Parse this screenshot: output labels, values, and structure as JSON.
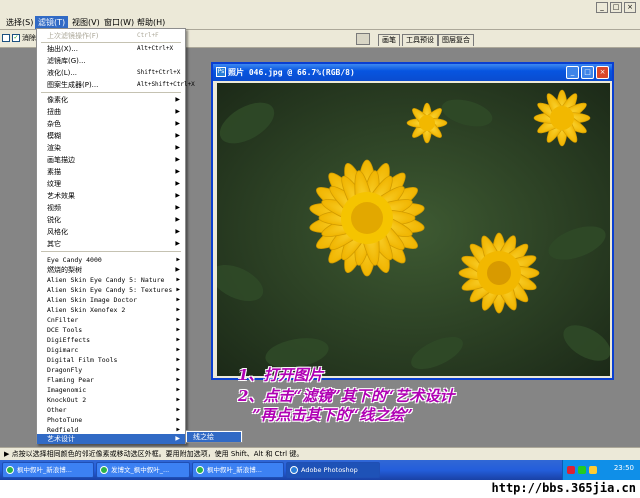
{
  "menubar": {
    "items": [
      "选择(S)",
      "滤镜(T)",
      "视图(V)",
      "窗口(W)",
      "帮助(H)"
    ],
    "active_index": 1,
    "window_controls": [
      "_",
      "□",
      "×"
    ]
  },
  "options_bar": {
    "checkbox_label": "消除",
    "palette_tabs": [
      "画笔",
      "工具预设",
      "图层复合"
    ]
  },
  "document": {
    "title": "照片 046.jpg @ 66.7%(RGB/8)",
    "controls": [
      "_",
      "□",
      "×"
    ]
  },
  "filter_menu": {
    "top_items": [
      {
        "label": "上次滤镜操作(F)",
        "shortcut": "Ctrl+F",
        "disabled": true
      },
      {
        "label": "抽出(X)...",
        "shortcut": "Alt+Ctrl+X"
      },
      {
        "label": "滤镜库(G)...",
        "shortcut": ""
      },
      {
        "label": "液化(L)...",
        "shortcut": "Shift+Ctrl+X"
      },
      {
        "label": "图案生成器(P)...",
        "shortcut": "Alt+Shift+Ctrl+X"
      }
    ],
    "groups": [
      "像素化",
      "扭曲",
      "杂色",
      "模糊",
      "渲染",
      "画笔描边",
      "素描",
      "纹理",
      "艺术效果",
      "视频",
      "锐化",
      "风格化",
      "其它"
    ],
    "plugins": [
      "Eye Candy 4000",
      "燃烧的梨树",
      "Alien Skin Eye Candy 5: Nature",
      "Alien Skin Eye Candy 5: Textures",
      "Alien Skin Image Doctor",
      "Alien Skin Xenofex 2",
      "CnFilter",
      "DCE Tools",
      "DigiEffects",
      "Digimarc",
      "Digital Film Tools",
      "DragonFly",
      "Flaming Pear",
      "Imagenomic",
      "KnockOut 2",
      "Other",
      "PhotoTune",
      "Redfield",
      "艺术设计"
    ],
    "submenu_item": "线之绘"
  },
  "annotation": {
    "line1": "1、打开图片",
    "line2": "2、点击“滤镜”其下的“艺术设计",
    "line3": "”再点击其下的“线之绘”"
  },
  "status_bar": {
    "text": "▶ 点按以选择相同颜色的邻近像素或移动选区外框。要用附加选项，使用 Shift、Alt 和 Ctrl 键。"
  },
  "taskbar": {
    "buttons": [
      "枫中叙叶_新浪博...",
      "发博文_枫中叙叶_...",
      "枫中叙叶_新浪博...",
      "Adobe Photoshop"
    ],
    "active_index": 3,
    "clock": "23:50"
  },
  "watermark": "http://bbs.365jia.cn",
  "colors": {
    "menu_highlight": "#316ac5",
    "annotation": "#b000b4",
    "title_bar": "#0755e0",
    "taskbar": "#245edb"
  }
}
